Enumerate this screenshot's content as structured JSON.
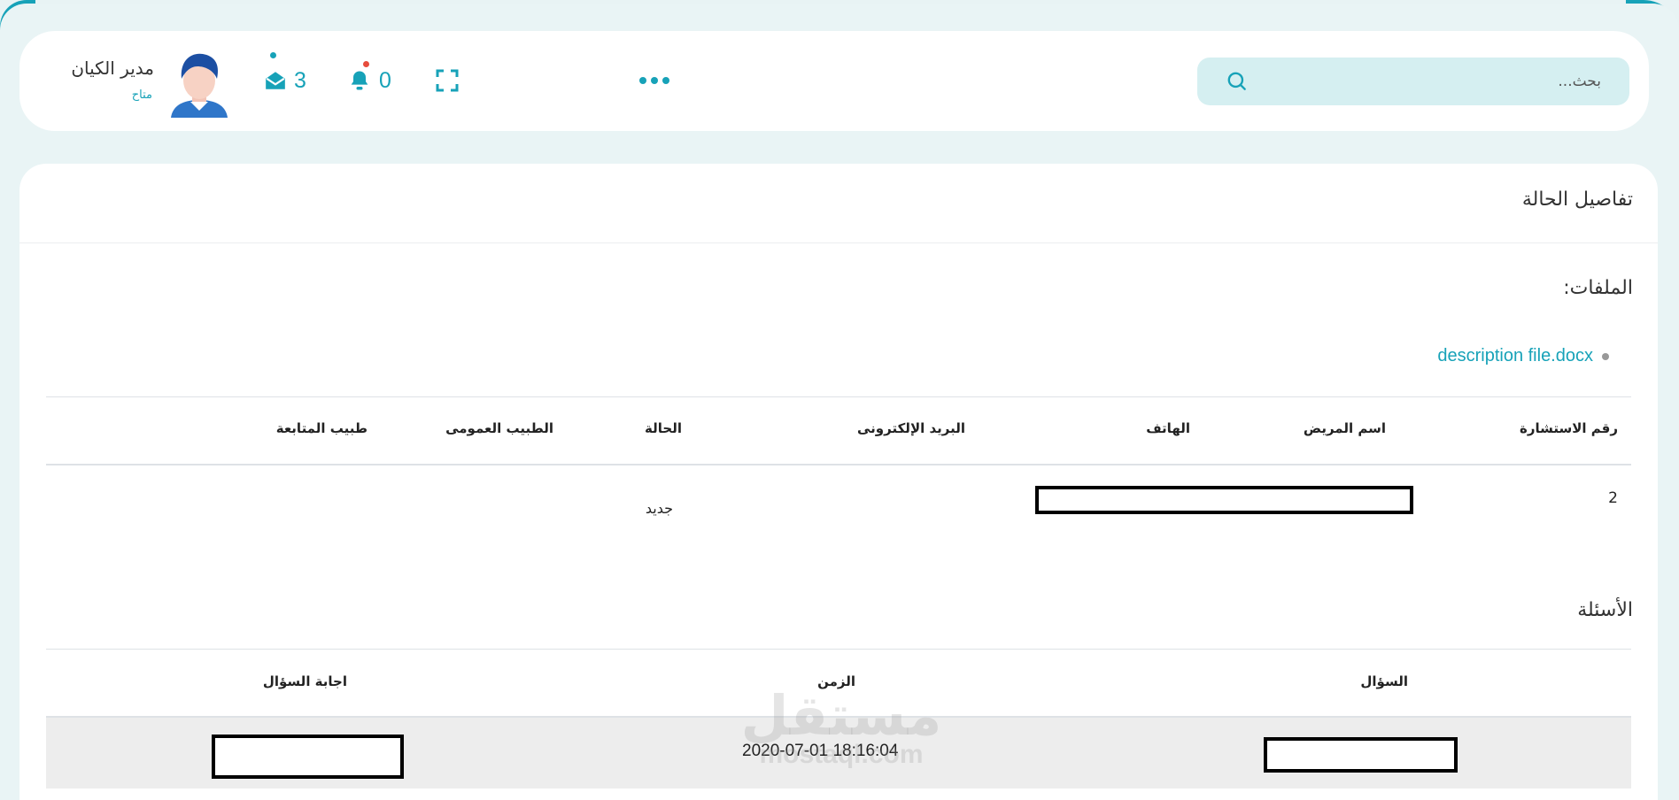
{
  "header": {
    "search_placeholder": "بحث...",
    "notifications_count": "0",
    "messages_count": "3",
    "user": {
      "name": "مدير الكيان",
      "status": "متاح"
    }
  },
  "card": {
    "title": "تفاصيل الحالة",
    "files_label": "الملفات:",
    "files": [
      {
        "name": "description file.docx"
      }
    ],
    "consult_table": {
      "headers": [
        "رقم الاستشارة",
        "اسم المريض",
        "الهاتف",
        "البريد الإلكترونى",
        "الحالة",
        "الطبيب العمومى",
        "طبيب المتابعة"
      ],
      "row": {
        "consult_no": "2",
        "status": "جديد"
      }
    },
    "questions_label": "الأسئلة",
    "questions_table": {
      "headers": [
        "السؤال",
        "الزمن",
        "اجابة السؤال"
      ],
      "row": {
        "time": "2020-07-01 18:16:04"
      }
    }
  },
  "watermark": {
    "arabic": "مستقل",
    "latin": "mostaql.com"
  },
  "colors": {
    "accent": "#17a2b8",
    "search_bg": "#d5eff1",
    "page_bg": "#e8f3f4",
    "row_bg": "#ededed"
  }
}
